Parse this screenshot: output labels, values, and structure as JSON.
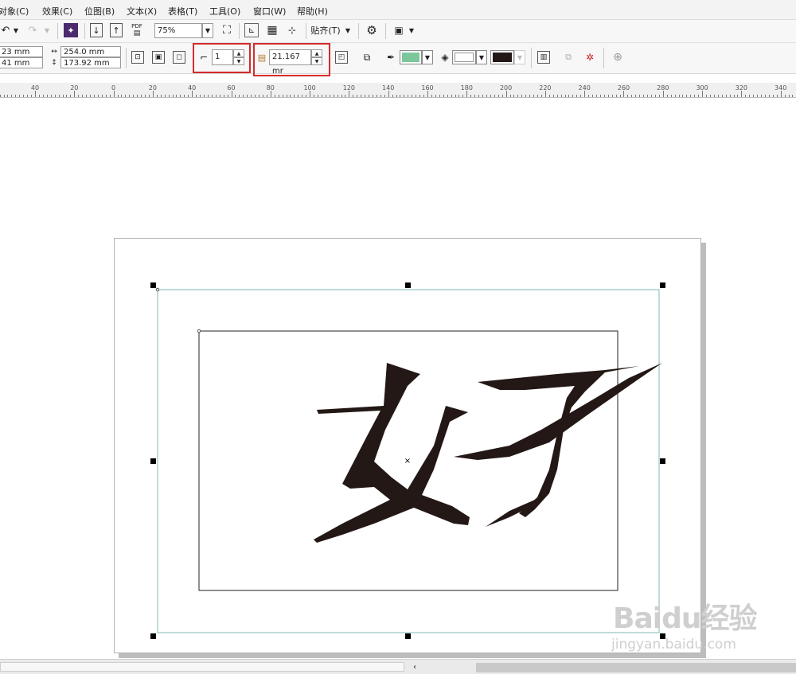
{
  "menu": [
    "对象(C)",
    "效果(C)",
    "位图(B)",
    "文本(X)",
    "表格(T)",
    "工具(O)",
    "窗口(W)",
    "帮助(H)"
  ],
  "toolbar": {
    "zoom_value": "75%",
    "pdf_label": "PDF",
    "snap_label": "贴齐(T)"
  },
  "property_bar": {
    "x_value": "23 mm",
    "y_value": "41 mm",
    "width_value": "254.0 mm",
    "height_value": "173.92 mm",
    "steps_value": "1",
    "offset_value": "21.167 mr",
    "fill_color": "#7cc79a",
    "outline_color": "#ffffff",
    "dark_color": "#231815"
  },
  "ruler_labels": [
    "40",
    "20",
    "0",
    "20",
    "40",
    "60",
    "80",
    "100",
    "120",
    "140",
    "160",
    "180",
    "200",
    "220",
    "240",
    "260",
    "280",
    "300",
    "320",
    "340"
  ],
  "canvas": {
    "glyph1": "女",
    "glyph2": "子"
  },
  "watermark": {
    "brand": "Baidu经验",
    "url": "jingyan.baidu.com"
  }
}
